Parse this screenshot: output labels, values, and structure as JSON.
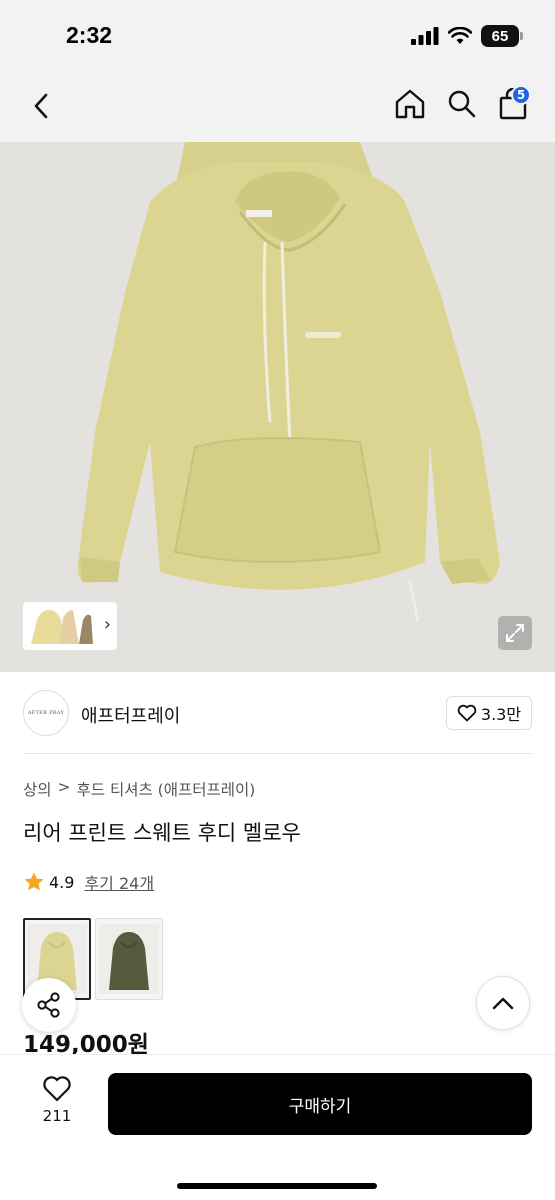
{
  "status_bar": {
    "time": "2:32",
    "battery": "65"
  },
  "nav": {
    "cart_count": "5"
  },
  "brand": {
    "logo_text": "AFTER PRAY",
    "name": "애프터프레이",
    "likes": "3.3만"
  },
  "breadcrumb": {
    "category": "상의",
    "separator": ">",
    "subcategory": "후드 티셔츠 (애프터프레이)"
  },
  "product": {
    "title": "리어 프린트 스웨트 후디 멜로우",
    "rating": "4.9",
    "reviews": "후기 24개",
    "price": "149,000원"
  },
  "colors": {
    "hoodie_yellow": "#dcd592",
    "hoodie_olive": "#565b3e"
  },
  "bottom_bar": {
    "wish_count": "211",
    "buy_label": "구매하기"
  }
}
